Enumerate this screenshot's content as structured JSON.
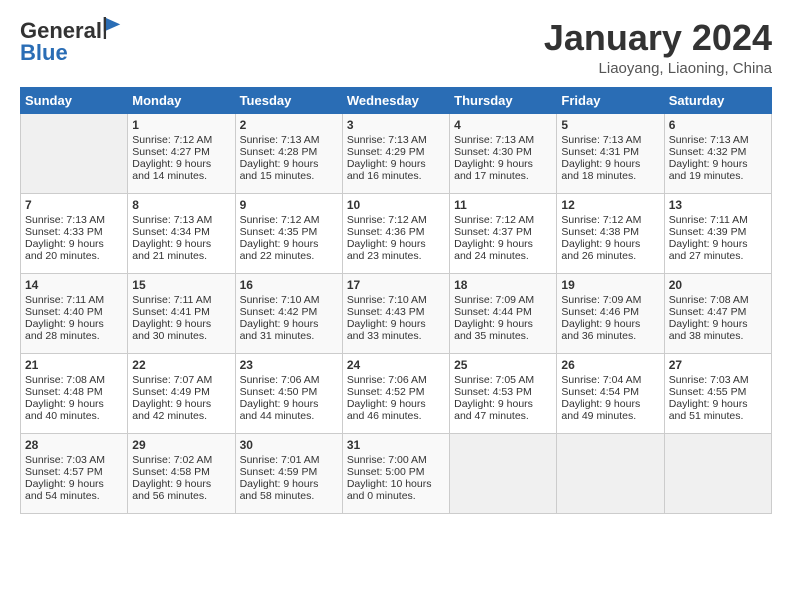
{
  "logo": {
    "general": "General",
    "blue": "Blue"
  },
  "header": {
    "month": "January 2024",
    "location": "Liaoyang, Liaoning, China"
  },
  "weekdays": [
    "Sunday",
    "Monday",
    "Tuesday",
    "Wednesday",
    "Thursday",
    "Friday",
    "Saturday"
  ],
  "weeks": [
    [
      {
        "day": "",
        "empty": true
      },
      {
        "day": "1",
        "sunrise": "Sunrise: 7:12 AM",
        "sunset": "Sunset: 4:27 PM",
        "daylight": "Daylight: 9 hours and 14 minutes."
      },
      {
        "day": "2",
        "sunrise": "Sunrise: 7:13 AM",
        "sunset": "Sunset: 4:28 PM",
        "daylight": "Daylight: 9 hours and 15 minutes."
      },
      {
        "day": "3",
        "sunrise": "Sunrise: 7:13 AM",
        "sunset": "Sunset: 4:29 PM",
        "daylight": "Daylight: 9 hours and 16 minutes."
      },
      {
        "day": "4",
        "sunrise": "Sunrise: 7:13 AM",
        "sunset": "Sunset: 4:30 PM",
        "daylight": "Daylight: 9 hours and 17 minutes."
      },
      {
        "day": "5",
        "sunrise": "Sunrise: 7:13 AM",
        "sunset": "Sunset: 4:31 PM",
        "daylight": "Daylight: 9 hours and 18 minutes."
      },
      {
        "day": "6",
        "sunrise": "Sunrise: 7:13 AM",
        "sunset": "Sunset: 4:32 PM",
        "daylight": "Daylight: 9 hours and 19 minutes."
      }
    ],
    [
      {
        "day": "7",
        "sunrise": "Sunrise: 7:13 AM",
        "sunset": "Sunset: 4:33 PM",
        "daylight": "Daylight: 9 hours and 20 minutes."
      },
      {
        "day": "8",
        "sunrise": "Sunrise: 7:13 AM",
        "sunset": "Sunset: 4:34 PM",
        "daylight": "Daylight: 9 hours and 21 minutes."
      },
      {
        "day": "9",
        "sunrise": "Sunrise: 7:12 AM",
        "sunset": "Sunset: 4:35 PM",
        "daylight": "Daylight: 9 hours and 22 minutes."
      },
      {
        "day": "10",
        "sunrise": "Sunrise: 7:12 AM",
        "sunset": "Sunset: 4:36 PM",
        "daylight": "Daylight: 9 hours and 23 minutes."
      },
      {
        "day": "11",
        "sunrise": "Sunrise: 7:12 AM",
        "sunset": "Sunset: 4:37 PM",
        "daylight": "Daylight: 9 hours and 24 minutes."
      },
      {
        "day": "12",
        "sunrise": "Sunrise: 7:12 AM",
        "sunset": "Sunset: 4:38 PM",
        "daylight": "Daylight: 9 hours and 26 minutes."
      },
      {
        "day": "13",
        "sunrise": "Sunrise: 7:11 AM",
        "sunset": "Sunset: 4:39 PM",
        "daylight": "Daylight: 9 hours and 27 minutes."
      }
    ],
    [
      {
        "day": "14",
        "sunrise": "Sunrise: 7:11 AM",
        "sunset": "Sunset: 4:40 PM",
        "daylight": "Daylight: 9 hours and 28 minutes."
      },
      {
        "day": "15",
        "sunrise": "Sunrise: 7:11 AM",
        "sunset": "Sunset: 4:41 PM",
        "daylight": "Daylight: 9 hours and 30 minutes."
      },
      {
        "day": "16",
        "sunrise": "Sunrise: 7:10 AM",
        "sunset": "Sunset: 4:42 PM",
        "daylight": "Daylight: 9 hours and 31 minutes."
      },
      {
        "day": "17",
        "sunrise": "Sunrise: 7:10 AM",
        "sunset": "Sunset: 4:43 PM",
        "daylight": "Daylight: 9 hours and 33 minutes."
      },
      {
        "day": "18",
        "sunrise": "Sunrise: 7:09 AM",
        "sunset": "Sunset: 4:44 PM",
        "daylight": "Daylight: 9 hours and 35 minutes."
      },
      {
        "day": "19",
        "sunrise": "Sunrise: 7:09 AM",
        "sunset": "Sunset: 4:46 PM",
        "daylight": "Daylight: 9 hours and 36 minutes."
      },
      {
        "day": "20",
        "sunrise": "Sunrise: 7:08 AM",
        "sunset": "Sunset: 4:47 PM",
        "daylight": "Daylight: 9 hours and 38 minutes."
      }
    ],
    [
      {
        "day": "21",
        "sunrise": "Sunrise: 7:08 AM",
        "sunset": "Sunset: 4:48 PM",
        "daylight": "Daylight: 9 hours and 40 minutes."
      },
      {
        "day": "22",
        "sunrise": "Sunrise: 7:07 AM",
        "sunset": "Sunset: 4:49 PM",
        "daylight": "Daylight: 9 hours and 42 minutes."
      },
      {
        "day": "23",
        "sunrise": "Sunrise: 7:06 AM",
        "sunset": "Sunset: 4:50 PM",
        "daylight": "Daylight: 9 hours and 44 minutes."
      },
      {
        "day": "24",
        "sunrise": "Sunrise: 7:06 AM",
        "sunset": "Sunset: 4:52 PM",
        "daylight": "Daylight: 9 hours and 46 minutes."
      },
      {
        "day": "25",
        "sunrise": "Sunrise: 7:05 AM",
        "sunset": "Sunset: 4:53 PM",
        "daylight": "Daylight: 9 hours and 47 minutes."
      },
      {
        "day": "26",
        "sunrise": "Sunrise: 7:04 AM",
        "sunset": "Sunset: 4:54 PM",
        "daylight": "Daylight: 9 hours and 49 minutes."
      },
      {
        "day": "27",
        "sunrise": "Sunrise: 7:03 AM",
        "sunset": "Sunset: 4:55 PM",
        "daylight": "Daylight: 9 hours and 51 minutes."
      }
    ],
    [
      {
        "day": "28",
        "sunrise": "Sunrise: 7:03 AM",
        "sunset": "Sunset: 4:57 PM",
        "daylight": "Daylight: 9 hours and 54 minutes."
      },
      {
        "day": "29",
        "sunrise": "Sunrise: 7:02 AM",
        "sunset": "Sunset: 4:58 PM",
        "daylight": "Daylight: 9 hours and 56 minutes."
      },
      {
        "day": "30",
        "sunrise": "Sunrise: 7:01 AM",
        "sunset": "Sunset: 4:59 PM",
        "daylight": "Daylight: 9 hours and 58 minutes."
      },
      {
        "day": "31",
        "sunrise": "Sunrise: 7:00 AM",
        "sunset": "Sunset: 5:00 PM",
        "daylight": "Daylight: 10 hours and 0 minutes."
      },
      {
        "day": "",
        "empty": true
      },
      {
        "day": "",
        "empty": true
      },
      {
        "day": "",
        "empty": true
      }
    ]
  ]
}
